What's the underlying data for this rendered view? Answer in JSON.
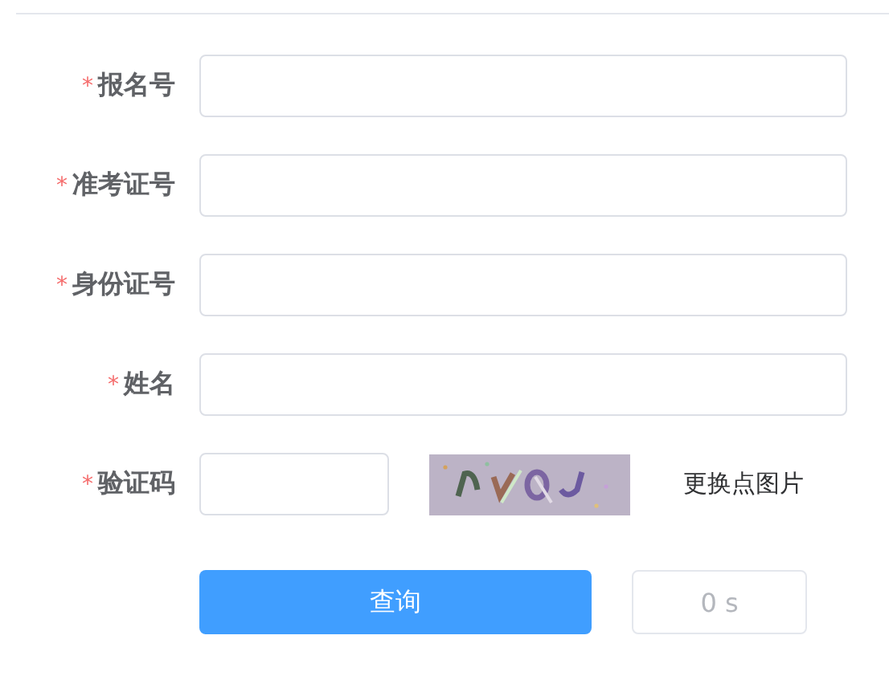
{
  "fields": [
    {
      "kind": "text",
      "required_mark": "*",
      "label": "报名号"
    },
    {
      "kind": "text",
      "required_mark": "*",
      "label": "准考证号"
    },
    {
      "kind": "text",
      "required_mark": "*",
      "label": "身份证号"
    },
    {
      "kind": "text",
      "required_mark": "*",
      "label": "姓名"
    },
    {
      "kind": "captcha",
      "required_mark": "*",
      "label": "验证码",
      "refresh_link": "更换点图片"
    }
  ],
  "submit_button": "查询",
  "countdown": {
    "text": "0 s",
    "disabled": true
  }
}
